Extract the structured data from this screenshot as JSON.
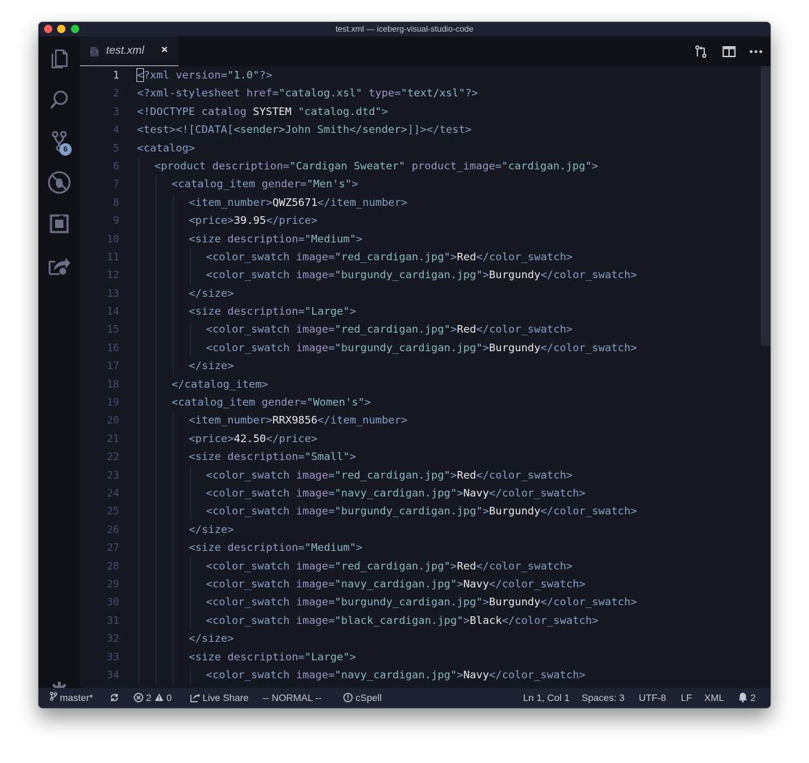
{
  "window": {
    "title": "test.xml — iceberg-visual-studio-code"
  },
  "activity_bar": {
    "scm_badge": "6"
  },
  "tab": {
    "title": "test.xml",
    "close_glyph": "×"
  },
  "editor": {
    "lines": [
      {
        "n": "1",
        "d": 0,
        "t": [
          [
            "tg",
            "<?xml "
          ],
          [
            "at",
            "version"
          ],
          [
            "tg",
            "="
          ],
          [
            "st",
            "\"1.0\""
          ],
          [
            "tg",
            "?>"
          ]
        ]
      },
      {
        "n": "2",
        "d": 0,
        "t": [
          [
            "tg",
            "<?xml-stylesheet "
          ],
          [
            "at",
            "href"
          ],
          [
            "tg",
            "="
          ],
          [
            "st",
            "\"catalog.xsl\""
          ],
          [
            "tg",
            " "
          ],
          [
            "at",
            "type"
          ],
          [
            "tg",
            "="
          ],
          [
            "st",
            "\"text/xsl\""
          ],
          [
            "tg",
            "?>"
          ]
        ]
      },
      {
        "n": "3",
        "d": 0,
        "t": [
          [
            "tg",
            "<!DOCTYPE "
          ],
          [
            "at",
            "catalog "
          ],
          [
            "tx",
            "SYSTEM "
          ],
          [
            "st",
            "\"catalog.dtd\""
          ],
          [
            "tg",
            ">"
          ]
        ]
      },
      {
        "n": "4",
        "d": 0,
        "t": [
          [
            "tg",
            "<test><![CDATA["
          ],
          [
            "st",
            "<sender>John Smith</sender>"
          ],
          [
            "tg",
            "]]></test>"
          ]
        ]
      },
      {
        "n": "5",
        "d": 0,
        "t": [
          [
            "tg",
            "<catalog>"
          ]
        ]
      },
      {
        "n": "6",
        "d": 1,
        "t": [
          [
            "tg",
            "<product "
          ],
          [
            "at",
            "description"
          ],
          [
            "tg",
            "="
          ],
          [
            "st",
            "\"Cardigan Sweater\""
          ],
          [
            "tg",
            " "
          ],
          [
            "at",
            "product_image"
          ],
          [
            "tg",
            "="
          ],
          [
            "st",
            "\"cardigan.jpg\""
          ],
          [
            "tg",
            ">"
          ]
        ]
      },
      {
        "n": "7",
        "d": 2,
        "t": [
          [
            "tg",
            "<catalog_item "
          ],
          [
            "at",
            "gender"
          ],
          [
            "tg",
            "="
          ],
          [
            "st",
            "\"Men's\""
          ],
          [
            "tg",
            ">"
          ]
        ]
      },
      {
        "n": "8",
        "d": 3,
        "t": [
          [
            "tg",
            "<item_number>"
          ],
          [
            "tx",
            "QWZ5671"
          ],
          [
            "tg",
            "</item_number>"
          ]
        ]
      },
      {
        "n": "9",
        "d": 3,
        "t": [
          [
            "tg",
            "<price>"
          ],
          [
            "tx",
            "39.95"
          ],
          [
            "tg",
            "</price>"
          ]
        ]
      },
      {
        "n": "10",
        "d": 3,
        "t": [
          [
            "tg",
            "<size "
          ],
          [
            "at",
            "description"
          ],
          [
            "tg",
            "="
          ],
          [
            "st",
            "\"Medium\""
          ],
          [
            "tg",
            ">"
          ]
        ]
      },
      {
        "n": "11",
        "d": 4,
        "t": [
          [
            "tg",
            "<color_swatch "
          ],
          [
            "at",
            "image"
          ],
          [
            "tg",
            "="
          ],
          [
            "st",
            "\"red_cardigan.jpg\""
          ],
          [
            "tg",
            ">"
          ],
          [
            "tx",
            "Red"
          ],
          [
            "tg",
            "</color_swatch>"
          ]
        ]
      },
      {
        "n": "12",
        "d": 4,
        "t": [
          [
            "tg",
            "<color_swatch "
          ],
          [
            "at",
            "image"
          ],
          [
            "tg",
            "="
          ],
          [
            "st",
            "\"burgundy_cardigan.jpg\""
          ],
          [
            "tg",
            ">"
          ],
          [
            "tx",
            "Burgundy"
          ],
          [
            "tg",
            "</color_swatch>"
          ]
        ]
      },
      {
        "n": "13",
        "d": 3,
        "t": [
          [
            "tg",
            "</size>"
          ]
        ]
      },
      {
        "n": "14",
        "d": 3,
        "t": [
          [
            "tg",
            "<size "
          ],
          [
            "at",
            "description"
          ],
          [
            "tg",
            "="
          ],
          [
            "st",
            "\"Large\""
          ],
          [
            "tg",
            ">"
          ]
        ]
      },
      {
        "n": "15",
        "d": 4,
        "t": [
          [
            "tg",
            "<color_swatch "
          ],
          [
            "at",
            "image"
          ],
          [
            "tg",
            "="
          ],
          [
            "st",
            "\"red_cardigan.jpg\""
          ],
          [
            "tg",
            ">"
          ],
          [
            "tx",
            "Red"
          ],
          [
            "tg",
            "</color_swatch>"
          ]
        ]
      },
      {
        "n": "16",
        "d": 4,
        "t": [
          [
            "tg",
            "<color_swatch "
          ],
          [
            "at",
            "image"
          ],
          [
            "tg",
            "="
          ],
          [
            "st",
            "\"burgundy_cardigan.jpg\""
          ],
          [
            "tg",
            ">"
          ],
          [
            "tx",
            "Burgundy"
          ],
          [
            "tg",
            "</color_swatch>"
          ]
        ]
      },
      {
        "n": "17",
        "d": 3,
        "t": [
          [
            "tg",
            "</size>"
          ]
        ]
      },
      {
        "n": "18",
        "d": 2,
        "t": [
          [
            "tg",
            "</catalog_item>"
          ]
        ]
      },
      {
        "n": "19",
        "d": 2,
        "t": [
          [
            "tg",
            "<catalog_item "
          ],
          [
            "at",
            "gender"
          ],
          [
            "tg",
            "="
          ],
          [
            "st",
            "\"Women's\""
          ],
          [
            "tg",
            ">"
          ]
        ]
      },
      {
        "n": "20",
        "d": 3,
        "t": [
          [
            "tg",
            "<item_number>"
          ],
          [
            "tx",
            "RRX9856"
          ],
          [
            "tg",
            "</item_number>"
          ]
        ]
      },
      {
        "n": "21",
        "d": 3,
        "t": [
          [
            "tg",
            "<price>"
          ],
          [
            "tx",
            "42.50"
          ],
          [
            "tg",
            "</price>"
          ]
        ]
      },
      {
        "n": "22",
        "d": 3,
        "t": [
          [
            "tg",
            "<size "
          ],
          [
            "at",
            "description"
          ],
          [
            "tg",
            "="
          ],
          [
            "st",
            "\"Small\""
          ],
          [
            "tg",
            ">"
          ]
        ]
      },
      {
        "n": "23",
        "d": 4,
        "t": [
          [
            "tg",
            "<color_swatch "
          ],
          [
            "at",
            "image"
          ],
          [
            "tg",
            "="
          ],
          [
            "st",
            "\"red_cardigan.jpg\""
          ],
          [
            "tg",
            ">"
          ],
          [
            "tx",
            "Red"
          ],
          [
            "tg",
            "</color_swatch>"
          ]
        ]
      },
      {
        "n": "24",
        "d": 4,
        "t": [
          [
            "tg",
            "<color_swatch "
          ],
          [
            "at",
            "image"
          ],
          [
            "tg",
            "="
          ],
          [
            "st",
            "\"navy_cardigan.jpg\""
          ],
          [
            "tg",
            ">"
          ],
          [
            "tx",
            "Navy"
          ],
          [
            "tg",
            "</color_swatch>"
          ]
        ]
      },
      {
        "n": "25",
        "d": 4,
        "t": [
          [
            "tg",
            "<color_swatch "
          ],
          [
            "at",
            "image"
          ],
          [
            "tg",
            "="
          ],
          [
            "st",
            "\"burgundy_cardigan.jpg\""
          ],
          [
            "tg",
            ">"
          ],
          [
            "tx",
            "Burgundy"
          ],
          [
            "tg",
            "</color_swatch>"
          ]
        ]
      },
      {
        "n": "26",
        "d": 3,
        "t": [
          [
            "tg",
            "</size>"
          ]
        ]
      },
      {
        "n": "27",
        "d": 3,
        "t": [
          [
            "tg",
            "<size "
          ],
          [
            "at",
            "description"
          ],
          [
            "tg",
            "="
          ],
          [
            "st",
            "\"Medium\""
          ],
          [
            "tg",
            ">"
          ]
        ]
      },
      {
        "n": "28",
        "d": 4,
        "t": [
          [
            "tg",
            "<color_swatch "
          ],
          [
            "at",
            "image"
          ],
          [
            "tg",
            "="
          ],
          [
            "st",
            "\"red_cardigan.jpg\""
          ],
          [
            "tg",
            ">"
          ],
          [
            "tx",
            "Red"
          ],
          [
            "tg",
            "</color_swatch>"
          ]
        ]
      },
      {
        "n": "29",
        "d": 4,
        "t": [
          [
            "tg",
            "<color_swatch "
          ],
          [
            "at",
            "image"
          ],
          [
            "tg",
            "="
          ],
          [
            "st",
            "\"navy_cardigan.jpg\""
          ],
          [
            "tg",
            ">"
          ],
          [
            "tx",
            "Navy"
          ],
          [
            "tg",
            "</color_swatch>"
          ]
        ]
      },
      {
        "n": "30",
        "d": 4,
        "t": [
          [
            "tg",
            "<color_swatch "
          ],
          [
            "at",
            "image"
          ],
          [
            "tg",
            "="
          ],
          [
            "st",
            "\"burgundy_cardigan.jpg\""
          ],
          [
            "tg",
            ">"
          ],
          [
            "tx",
            "Burgundy"
          ],
          [
            "tg",
            "</color_swatch>"
          ]
        ]
      },
      {
        "n": "31",
        "d": 4,
        "t": [
          [
            "tg",
            "<color_swatch "
          ],
          [
            "at",
            "image"
          ],
          [
            "tg",
            "="
          ],
          [
            "st",
            "\"black_cardigan.jpg\""
          ],
          [
            "tg",
            ">"
          ],
          [
            "tx",
            "Black"
          ],
          [
            "tg",
            "</color_swatch>"
          ]
        ]
      },
      {
        "n": "32",
        "d": 3,
        "t": [
          [
            "tg",
            "</size>"
          ]
        ]
      },
      {
        "n": "33",
        "d": 3,
        "t": [
          [
            "tg",
            "<size "
          ],
          [
            "at",
            "description"
          ],
          [
            "tg",
            "="
          ],
          [
            "st",
            "\"Large\""
          ],
          [
            "tg",
            ">"
          ]
        ]
      },
      {
        "n": "34",
        "d": 4,
        "t": [
          [
            "tg",
            "<color_swatch "
          ],
          [
            "at",
            "image"
          ],
          [
            "tg",
            "="
          ],
          [
            "st",
            "\"navy_cardigan.jpg\""
          ],
          [
            "tg",
            ">"
          ],
          [
            "tx",
            "Navy"
          ],
          [
            "tg",
            "</color_swatch>"
          ]
        ]
      }
    ]
  },
  "status": {
    "branch": "master*",
    "errors": "2",
    "warnings": "0",
    "live_share": "Live Share",
    "mode": "-- NORMAL --",
    "spell": "cSpell",
    "position": "Ln 1, Col 1",
    "spaces": "Spaces: 3",
    "encoding": "UTF-8",
    "eol": "LF",
    "language": "XML",
    "notifications": "2"
  },
  "colors": {
    "background": "#161821",
    "tag": "#84a0c6",
    "attribute": "#a093c7",
    "string": "#89b8c2",
    "text": "#e8e9ec",
    "line_number": "#444b71"
  }
}
